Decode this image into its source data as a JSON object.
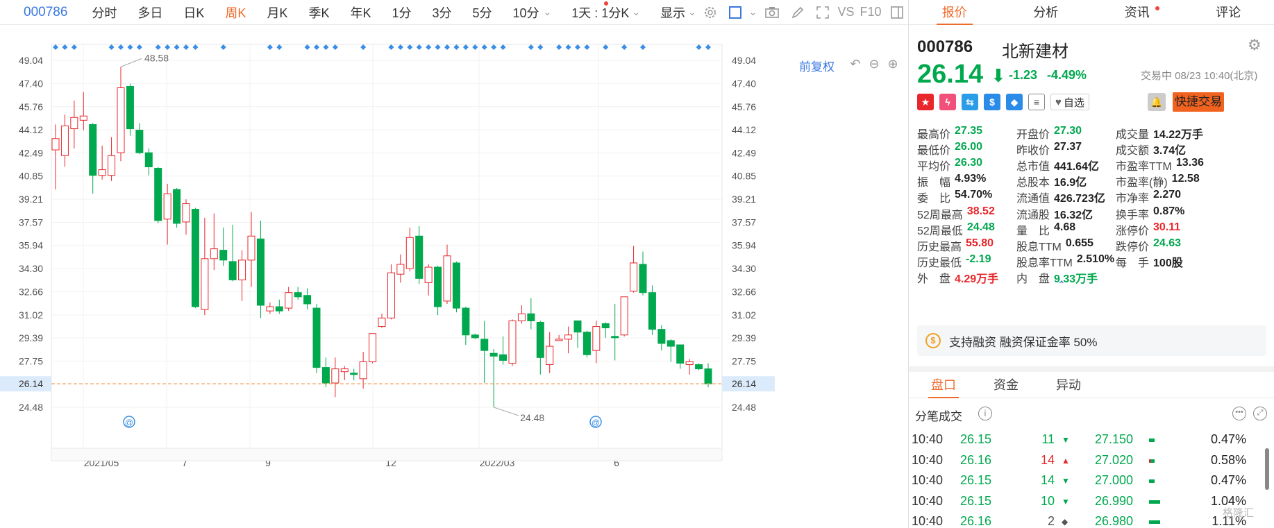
{
  "toolbar": {
    "code": "000786",
    "periods": [
      "分时",
      "多日",
      "日K",
      "周K",
      "月K",
      "季K",
      "年K",
      "1分",
      "3分",
      "5分",
      "10分"
    ],
    "active_period": "周K",
    "interval_label": "1天 : 1分K",
    "display_label": "显示",
    "vs_label": "VS",
    "f10_label": "F10"
  },
  "chart": {
    "fuquan_label": "前复权",
    "y_ticks": [
      "49.04",
      "47.40",
      "45.76",
      "44.12",
      "42.49",
      "40.85",
      "39.21",
      "37.57",
      "35.94",
      "34.30",
      "32.66",
      "31.02",
      "29.39",
      "27.75",
      "26.14",
      "24.48"
    ],
    "x_ticks": [
      "2021/05",
      "7",
      "9",
      "12",
      "2022/03",
      "6"
    ],
    "current_price_label": "26.14",
    "high_annotation": "48.58",
    "low_annotation": "24.48",
    "colors": {
      "up": "#e8262b",
      "down": "#00a84e",
      "dash": "#f5a25d",
      "marker": "#3a8ee6"
    }
  },
  "chart_data": {
    "type": "candlestick",
    "series": [
      {
        "o": 42.7,
        "h": 44.5,
        "l": 39.9,
        "c": 43.5
      },
      {
        "o": 42.3,
        "h": 45.2,
        "l": 41.5,
        "c": 44.4
      },
      {
        "o": 44.2,
        "h": 46.2,
        "l": 42.8,
        "c": 45.0
      },
      {
        "o": 44.8,
        "h": 46.8,
        "l": 44.1,
        "c": 45.1
      },
      {
        "o": 44.5,
        "h": 44.6,
        "l": 39.6,
        "c": 40.9
      },
      {
        "o": 40.9,
        "h": 43.0,
        "l": 40.6,
        "c": 41.3
      },
      {
        "o": 40.9,
        "h": 43.6,
        "l": 40.5,
        "c": 42.3
      },
      {
        "o": 42.5,
        "h": 48.58,
        "l": 41.9,
        "c": 47.1
      },
      {
        "o": 47.2,
        "h": 47.4,
        "l": 43.7,
        "c": 44.2
      },
      {
        "o": 44.1,
        "h": 44.6,
        "l": 42.4,
        "c": 42.5
      },
      {
        "o": 42.5,
        "h": 42.8,
        "l": 40.9,
        "c": 41.5
      },
      {
        "o": 41.4,
        "h": 41.5,
        "l": 37.5,
        "c": 37.7
      },
      {
        "o": 37.8,
        "h": 40.3,
        "l": 36.0,
        "c": 39.6
      },
      {
        "o": 39.9,
        "h": 40.0,
        "l": 37.2,
        "c": 37.5
      },
      {
        "o": 37.6,
        "h": 39.2,
        "l": 36.7,
        "c": 38.9
      },
      {
        "o": 38.5,
        "h": 38.6,
        "l": 31.5,
        "c": 31.6
      },
      {
        "o": 31.4,
        "h": 37.9,
        "l": 31.0,
        "c": 35.0
      },
      {
        "o": 35.0,
        "h": 38.2,
        "l": 34.2,
        "c": 35.7
      },
      {
        "o": 35.6,
        "h": 37.2,
        "l": 34.5,
        "c": 34.9
      },
      {
        "o": 34.8,
        "h": 37.4,
        "l": 33.4,
        "c": 33.5
      },
      {
        "o": 33.5,
        "h": 35.6,
        "l": 32.0,
        "c": 34.9
      },
      {
        "o": 34.9,
        "h": 38.3,
        "l": 33.0,
        "c": 36.6
      },
      {
        "o": 36.4,
        "h": 37.7,
        "l": 30.8,
        "c": 31.7
      },
      {
        "o": 31.3,
        "h": 31.9,
        "l": 31.1,
        "c": 31.6
      },
      {
        "o": 31.6,
        "h": 32.1,
        "l": 31.1,
        "c": 31.3
      },
      {
        "o": 31.5,
        "h": 33.0,
        "l": 31.3,
        "c": 32.6
      },
      {
        "o": 32.6,
        "h": 33.0,
        "l": 32.1,
        "c": 32.3
      },
      {
        "o": 32.4,
        "h": 32.9,
        "l": 31.4,
        "c": 31.8
      },
      {
        "o": 31.5,
        "h": 31.8,
        "l": 26.9,
        "c": 27.3
      },
      {
        "o": 27.3,
        "h": 28.0,
        "l": 25.9,
        "c": 26.2
      },
      {
        "o": 26.2,
        "h": 28.0,
        "l": 25.2,
        "c": 27.2
      },
      {
        "o": 27.0,
        "h": 27.4,
        "l": 26.4,
        "c": 27.2
      },
      {
        "o": 26.9,
        "h": 27.2,
        "l": 26.4,
        "c": 26.8
      },
      {
        "o": 26.5,
        "h": 28.4,
        "l": 25.8,
        "c": 27.7
      },
      {
        "o": 27.7,
        "h": 29.7,
        "l": 27.6,
        "c": 29.7
      },
      {
        "o": 30.2,
        "h": 31.1,
        "l": 30.1,
        "c": 30.8
      },
      {
        "o": 30.8,
        "h": 34.6,
        "l": 30.7,
        "c": 34.0
      },
      {
        "o": 33.9,
        "h": 35.3,
        "l": 33.3,
        "c": 34.6
      },
      {
        "o": 34.3,
        "h": 37.2,
        "l": 34.1,
        "c": 36.5
      },
      {
        "o": 36.6,
        "h": 37.3,
        "l": 33.2,
        "c": 33.6
      },
      {
        "o": 33.3,
        "h": 34.6,
        "l": 32.4,
        "c": 34.4
      },
      {
        "o": 34.4,
        "h": 34.5,
        "l": 31.0,
        "c": 31.6
      },
      {
        "o": 32.0,
        "h": 36.0,
        "l": 31.8,
        "c": 35.2
      },
      {
        "o": 34.7,
        "h": 34.8,
        "l": 31.2,
        "c": 31.5
      },
      {
        "o": 31.5,
        "h": 31.6,
        "l": 28.9,
        "c": 29.6
      },
      {
        "o": 29.6,
        "h": 29.7,
        "l": 29.3,
        "c": 29.4
      },
      {
        "o": 29.3,
        "h": 30.6,
        "l": 26.2,
        "c": 28.5
      },
      {
        "o": 28.3,
        "h": 28.6,
        "l": 24.48,
        "c": 28.1
      },
      {
        "o": 28.2,
        "h": 29.5,
        "l": 27.5,
        "c": 27.8
      },
      {
        "o": 27.6,
        "h": 30.7,
        "l": 27.4,
        "c": 30.6
      },
      {
        "o": 30.6,
        "h": 31.7,
        "l": 30.4,
        "c": 31.1
      },
      {
        "o": 31.1,
        "h": 32.2,
        "l": 30.0,
        "c": 30.6
      },
      {
        "o": 30.5,
        "h": 30.6,
        "l": 26.8,
        "c": 28.0
      },
      {
        "o": 27.5,
        "h": 29.8,
        "l": 26.9,
        "c": 28.8
      },
      {
        "o": 29.2,
        "h": 29.6,
        "l": 29.2,
        "c": 29.3
      },
      {
        "o": 29.3,
        "h": 30.2,
        "l": 28.3,
        "c": 29.6
      },
      {
        "o": 30.6,
        "h": 30.6,
        "l": 28.7,
        "c": 29.8
      },
      {
        "o": 29.8,
        "h": 29.9,
        "l": 28.0,
        "c": 28.2
      },
      {
        "o": 28.5,
        "h": 30.6,
        "l": 27.6,
        "c": 30.2
      },
      {
        "o": 30.4,
        "h": 30.5,
        "l": 29.4,
        "c": 30.1
      },
      {
        "o": 29.5,
        "h": 31.8,
        "l": 27.8,
        "c": 29.4
      },
      {
        "o": 29.6,
        "h": 32.3,
        "l": 29.5,
        "c": 32.3
      },
      {
        "o": 32.7,
        "h": 35.9,
        "l": 32.6,
        "c": 34.7
      },
      {
        "o": 34.6,
        "h": 35.5,
        "l": 32.4,
        "c": 32.6
      },
      {
        "o": 32.6,
        "h": 33.1,
        "l": 29.6,
        "c": 30.0
      },
      {
        "o": 30.0,
        "h": 30.3,
        "l": 28.5,
        "c": 29.0
      },
      {
        "o": 29.2,
        "h": 29.3,
        "l": 27.7,
        "c": 28.8
      },
      {
        "o": 28.9,
        "h": 28.9,
        "l": 27.2,
        "c": 27.6
      },
      {
        "o": 27.5,
        "h": 27.9,
        "l": 26.8,
        "c": 27.7
      },
      {
        "o": 27.5,
        "h": 27.6,
        "l": 27.1,
        "c": 27.2
      },
      {
        "o": 27.2,
        "h": 27.6,
        "l": 25.9,
        "c": 26.14
      }
    ],
    "ylim": [
      23.3,
      50.2
    ],
    "x_tick_labels": [
      "2021/05",
      "7",
      "9",
      "12",
      "2022/03",
      "6"
    ]
  },
  "stock": {
    "code": "000786",
    "name": "北新建材",
    "price": "26.14",
    "change": "-1.23",
    "change_pct": "-4.49%",
    "status": "交易中 08/23 10:40(北京)",
    "watch_label": "自选",
    "quick_trade": "快捷交易",
    "margin_note": "支持融资 融资保证金率 50%"
  },
  "panel_tabs": [
    "报价",
    "分析",
    "资讯",
    "评论"
  ],
  "stats": [
    [
      {
        "l": "最高价",
        "v": "27.35",
        "c": "green"
      },
      {
        "l": "开盘价",
        "v": "27.30",
        "c": "green"
      },
      {
        "l": "成交量",
        "v": "14.22万手",
        "c": "dark"
      }
    ],
    [
      {
        "l": "最低价",
        "v": "26.00",
        "c": "green"
      },
      {
        "l": "昨收价",
        "v": "27.37",
        "c": "dark"
      },
      {
        "l": "成交额",
        "v": "3.74亿",
        "c": "dark"
      }
    ],
    [
      {
        "l": "平均价",
        "v": "26.30",
        "c": "green"
      },
      {
        "l": "总市值",
        "v": "441.64亿",
        "c": "dark"
      },
      {
        "l": "市盈率TTM",
        "v": "13.36",
        "c": "dark"
      }
    ],
    [
      {
        "l": "振　幅",
        "v": "4.93%",
        "c": "dark"
      },
      {
        "l": "总股本",
        "v": "16.9亿",
        "c": "dark"
      },
      {
        "l": "市盈率(静)",
        "v": "12.58",
        "c": "dark"
      }
    ],
    [
      {
        "l": "委　比",
        "v": "54.70%",
        "c": "dark"
      },
      {
        "l": "流通值",
        "v": "426.723亿",
        "c": "dark"
      },
      {
        "l": "市净率",
        "v": "2.270",
        "c": "dark"
      }
    ],
    [
      {
        "l": "52周最高",
        "v": "38.52",
        "c": "red"
      },
      {
        "l": "流通股",
        "v": "16.32亿",
        "c": "dark"
      },
      {
        "l": "换手率",
        "v": "0.87%",
        "c": "dark"
      }
    ],
    [
      {
        "l": "52周最低",
        "v": "24.48",
        "c": "green"
      },
      {
        "l": "量　比",
        "v": "4.68",
        "c": "dark"
      },
      {
        "l": "涨停价",
        "v": "30.11",
        "c": "red"
      }
    ],
    [
      {
        "l": "历史最高",
        "v": "55.80",
        "c": "red"
      },
      {
        "l": "股息TTM",
        "v": "0.655",
        "c": "dark"
      },
      {
        "l": "跌停价",
        "v": "24.63",
        "c": "green"
      }
    ],
    [
      {
        "l": "历史最低",
        "v": "-2.19",
        "c": "green"
      },
      {
        "l": "股息率TTM",
        "v": "2.510%",
        "c": "dark"
      },
      {
        "l": "每　手",
        "v": "100股",
        "c": "dark"
      }
    ],
    [
      {
        "l": "外　盘",
        "v": "4.29万手",
        "c": "red"
      },
      {
        "l": "内　盘",
        "v": "9.33万手",
        "c": "green"
      },
      {
        "l": "",
        "v": "",
        "c": "dark"
      }
    ]
  ],
  "sub_tabs": [
    "盘口",
    "资金",
    "异动"
  ],
  "tick_header": "分笔成交",
  "ticks": [
    {
      "time": "10:40",
      "price": "26.15",
      "vol": "11",
      "dir": "down",
      "p2": "27.150",
      "bar": 8,
      "pct": "0.47%"
    },
    {
      "time": "10:40",
      "price": "26.16",
      "vol": "14",
      "dir": "up",
      "p2": "27.020",
      "bar": 8,
      "pct": "0.58%"
    },
    {
      "time": "10:40",
      "price": "26.15",
      "vol": "14",
      "dir": "down",
      "p2": "27.000",
      "bar": 8,
      "pct": "0.47%"
    },
    {
      "time": "10:40",
      "price": "26.15",
      "vol": "10",
      "dir": "down",
      "p2": "26.990",
      "bar": 16,
      "pct": "1.04%"
    },
    {
      "time": "10:40",
      "price": "26.16",
      "vol": "2",
      "dir": "flat",
      "p2": "26.980",
      "bar": 16,
      "pct": "1.11%"
    }
  ],
  "watermark": "格隆汇"
}
